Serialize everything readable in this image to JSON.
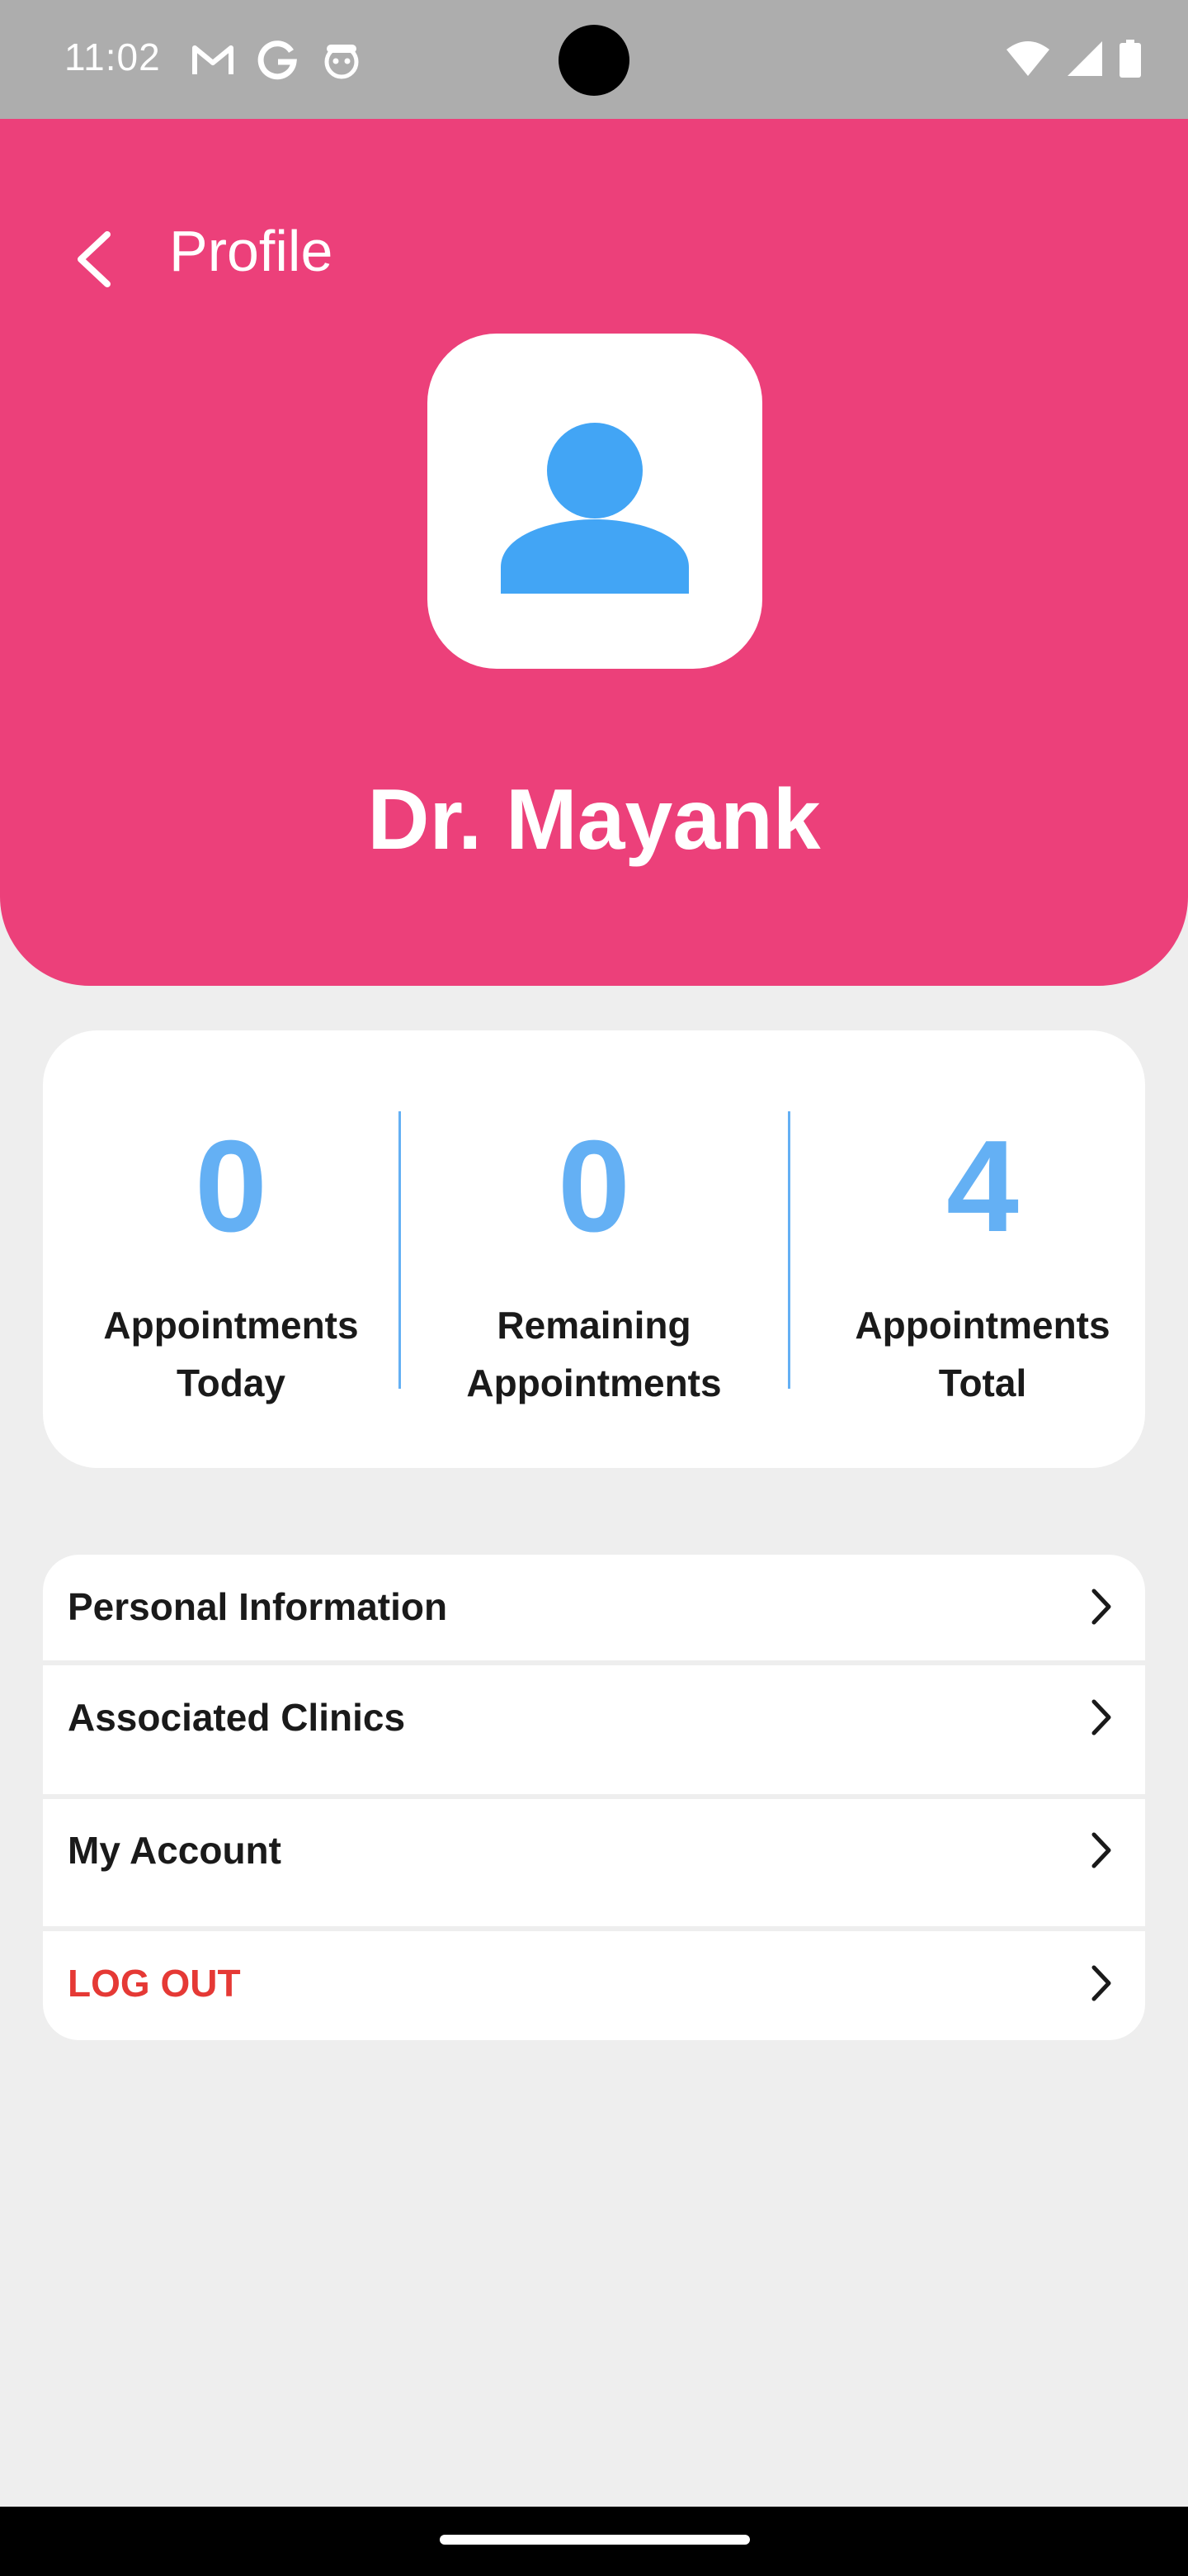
{
  "status_bar": {
    "time": "11:02",
    "left_icons": [
      "gmail-icon",
      "google-icon",
      "android-icon"
    ],
    "right_icons": [
      "wifi-icon",
      "signal-icon",
      "battery-icon"
    ]
  },
  "header": {
    "title": "Profile",
    "back_icon": "chevron-left-icon",
    "avatar_icon": "person-icon",
    "doctor_name": "Dr. Mayank",
    "color": "#ec407a"
  },
  "stats": [
    {
      "value": "0",
      "label": "Appointments\nToday"
    },
    {
      "value": "0",
      "label": "Remaining\nAppointments"
    },
    {
      "value": "4",
      "label": "Appointments\nTotal"
    }
  ],
  "menu": [
    {
      "label": "Personal Information"
    },
    {
      "label": "Associated Clinics"
    },
    {
      "label": "My Account"
    },
    {
      "label": "LOG OUT"
    }
  ],
  "colors": {
    "accent": "#ec407a",
    "stat_value": "#64b0f4",
    "avatar": "#42a5f5",
    "logout": "#e53935"
  }
}
